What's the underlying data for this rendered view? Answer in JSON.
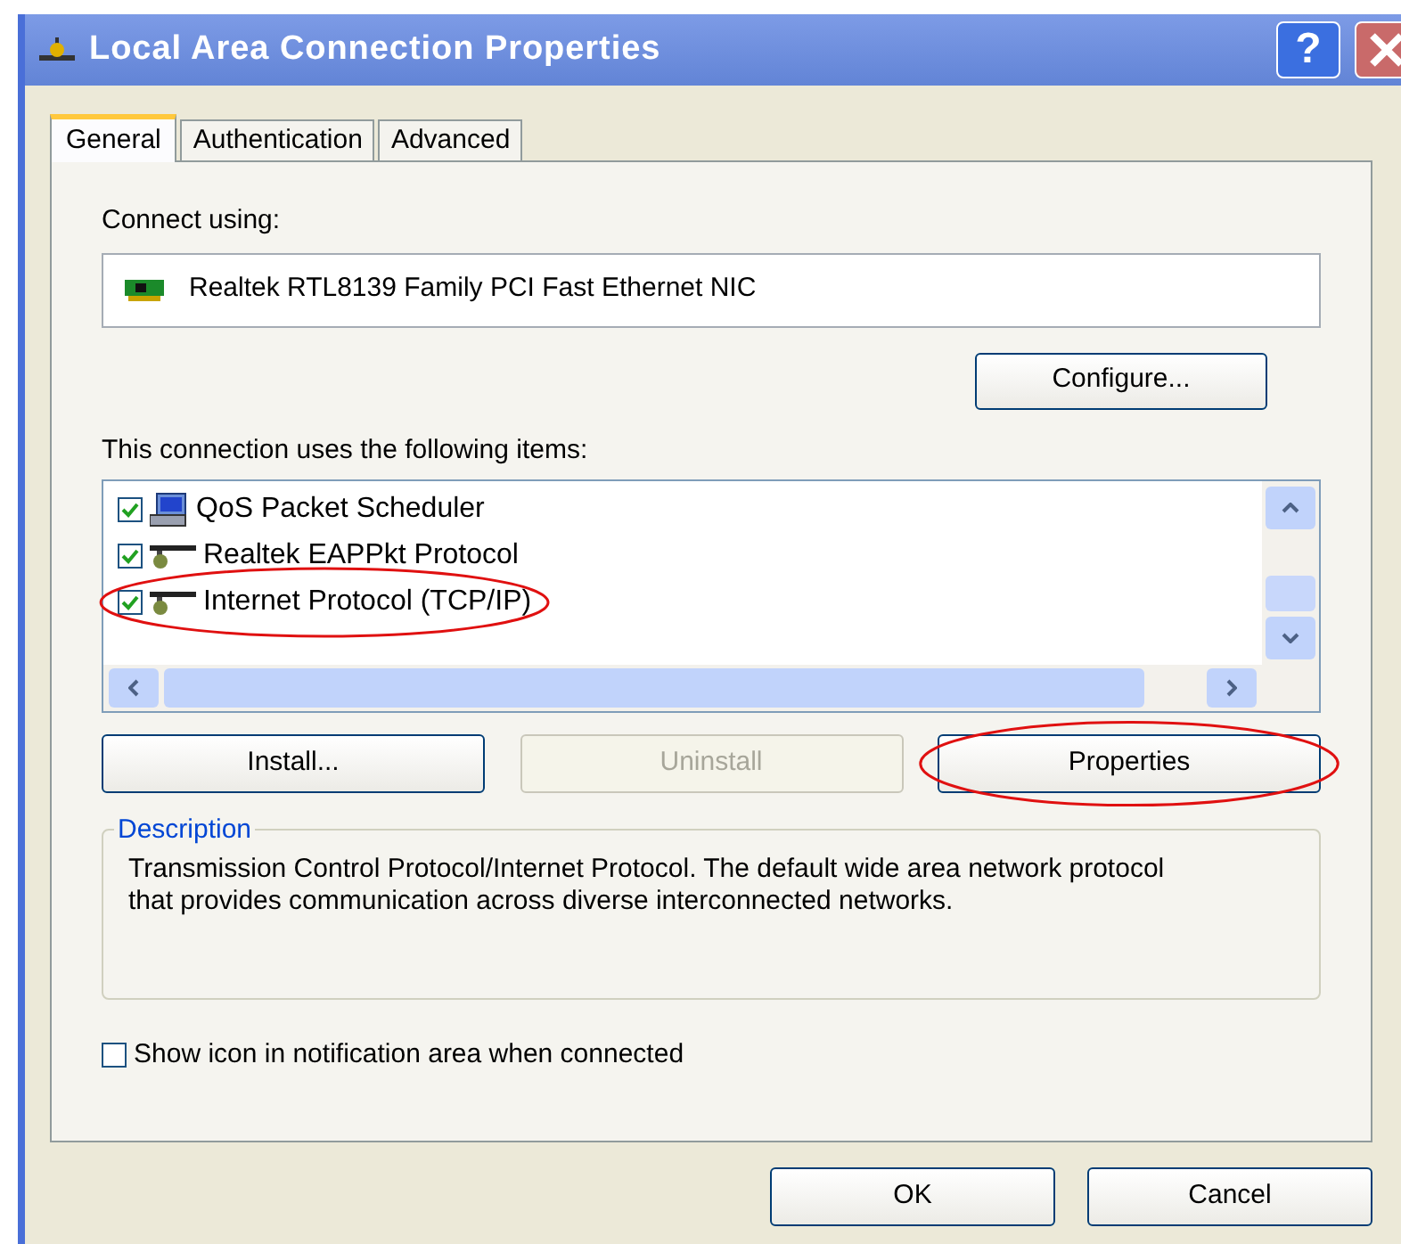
{
  "window": {
    "title": "Local Area Connection Properties",
    "help": "?"
  },
  "tabs": [
    {
      "label": "General",
      "selected": true
    },
    {
      "label": "Authentication",
      "selected": false
    },
    {
      "label": "Advanced",
      "selected": false
    }
  ],
  "connect_using": {
    "label": "Connect using:",
    "adapter": "Realtek RTL8139 Family PCI Fast Ethernet NIC",
    "button": "Configure..."
  },
  "items_label": "This connection uses the following items:",
  "items": [
    {
      "label": "QoS Packet Scheduler",
      "checked": true,
      "kind": "service",
      "circled": false
    },
    {
      "label": "Realtek EAPPkt Protocol",
      "checked": true,
      "kind": "protocol",
      "circled": false
    },
    {
      "label": "Internet Protocol (TCP/IP)",
      "checked": true,
      "kind": "protocol",
      "circled": true
    }
  ],
  "item_buttons": [
    {
      "label": "Install...",
      "disabled": false,
      "circled": false
    },
    {
      "label": "Uninstall",
      "disabled": true,
      "circled": false
    },
    {
      "label": "Properties",
      "disabled": false,
      "circled": true
    }
  ],
  "description": {
    "title": "Description",
    "text": "Transmission Control Protocol/Internet Protocol. The default wide area network protocol that provides communication across diverse interconnected networks."
  },
  "notify": {
    "label": "Show icon in notification area when connected",
    "checked": false
  },
  "buttons": [
    {
      "label": "OK"
    },
    {
      "label": "Cancel"
    }
  ]
}
